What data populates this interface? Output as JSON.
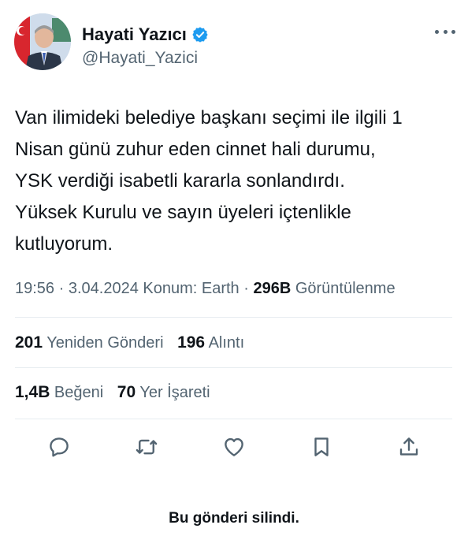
{
  "author": {
    "name": "Hayati Yazıcı",
    "handle": "@Hayati_Yazici",
    "verified_color": "#1d9bf0"
  },
  "tweet": {
    "lines": [
      "Van ilimideki belediye başkanı seçimi ile ilgili 1",
      "Nisan günü zuhur eden cinnet hali durumu,",
      "YSK verdiği isabetli kararla sonlandırdı.",
      "Yüksek Kurulu ve sayın üyeleri içtenlikle",
      "kutluyorum."
    ]
  },
  "meta": {
    "time": "19:56",
    "sep1": " · ",
    "date": "3.04.2024",
    "location": " Konum: Earth",
    "sep2": " · ",
    "views_count": "296B",
    "views_label": " Görüntülenme"
  },
  "stats": {
    "reposts_count": "201",
    "reposts_label": " Yeniden Gönderi",
    "quotes_count": "196",
    "quotes_label": " Alıntı",
    "likes_count": "1,4B",
    "likes_label": " Beğeni",
    "bookmarks_count": "70",
    "bookmarks_label": " Yer İşareti"
  },
  "actions": [
    "reply-icon",
    "repost-icon",
    "like-icon",
    "bookmark-icon",
    "share-icon"
  ],
  "footer": {
    "deleted_notice": "Bu gönderi silindi."
  },
  "colors": {
    "text": "#0f1419",
    "secondary": "#536471",
    "divider": "#e6ecf0",
    "brand": "#1d9bf0"
  }
}
